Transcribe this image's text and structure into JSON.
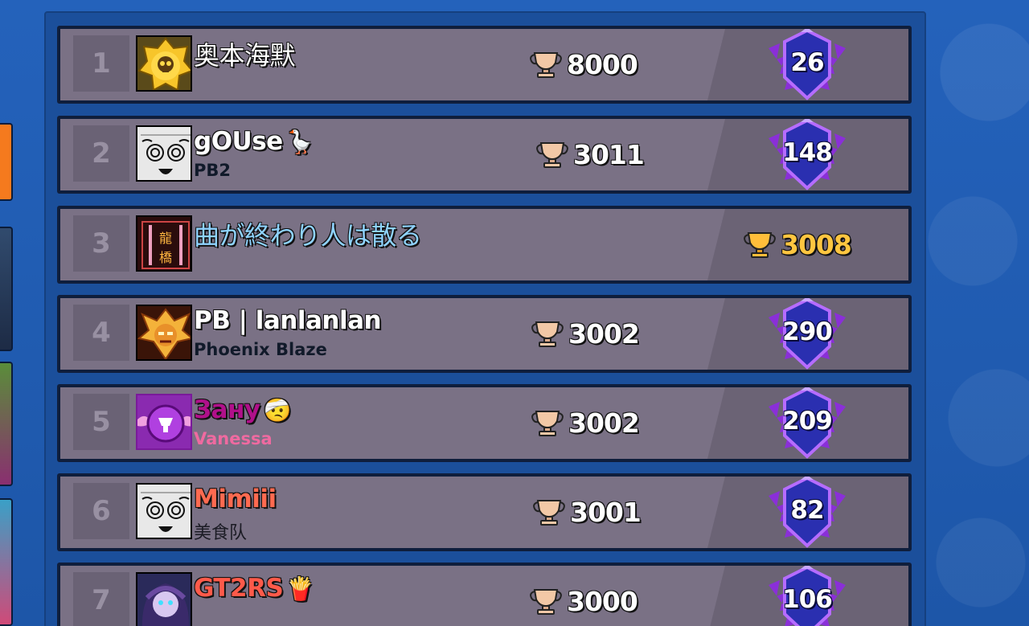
{
  "leaderboard": {
    "rows": [
      {
        "rank": "1",
        "name": "奥本海默",
        "club": "",
        "trophies": "8000",
        "badge": "26",
        "avatar_icon": "skull-emblem-icon",
        "name_color": "#ffffff",
        "club_color": "",
        "emoji": ""
      },
      {
        "rank": "2",
        "name": "gOUse",
        "club": "PB2",
        "trophies": "3011",
        "badge": "148",
        "avatar_icon": "manga-face-icon",
        "name_color": "#ffffff",
        "club_color": "#111a2a",
        "emoji": "🪿"
      },
      {
        "rank": "3",
        "name": "曲が終わり人は散る",
        "club": "",
        "trophies": "3008",
        "badge": "",
        "avatar_icon": "calligraphy-scroll-icon",
        "name_color": "#8fd3ff",
        "club_color": "",
        "emoji": ""
      },
      {
        "rank": "4",
        "name": "PB | lanlanlan",
        "club": "Phoenix Blaze",
        "trophies": "3002",
        "badge": "290",
        "avatar_icon": "golden-warrior-icon",
        "name_color": "#ffffff",
        "club_color": "#111a2a",
        "emoji": ""
      },
      {
        "rank": "5",
        "name": "Зану",
        "club": "Vanessa",
        "trophies": "3002",
        "badge": "209",
        "avatar_icon": "purple-winged-emblem-icon",
        "name_color": "#b0108a",
        "club_color": "#ef6aa0",
        "emoji": "🤕"
      },
      {
        "rank": "6",
        "name": "Mimiii",
        "club": "美食队",
        "trophies": "3001",
        "badge": "82",
        "avatar_icon": "manga-face-icon",
        "name_color": "#ff6a50",
        "club_color": "#1b1b24",
        "emoji": ""
      },
      {
        "rank": "7",
        "name": "GT2RS",
        "club": "",
        "trophies": "3000",
        "badge": "106",
        "avatar_icon": "anime-girl-icon",
        "name_color": "#ff5a4a",
        "club_color": "",
        "emoji": "🍟"
      }
    ]
  },
  "colors": {
    "background": "#1f5bb0",
    "row_fill": "#7a7185",
    "row_border": "#0f1e3c",
    "trophy_gold": "#ffc640"
  }
}
